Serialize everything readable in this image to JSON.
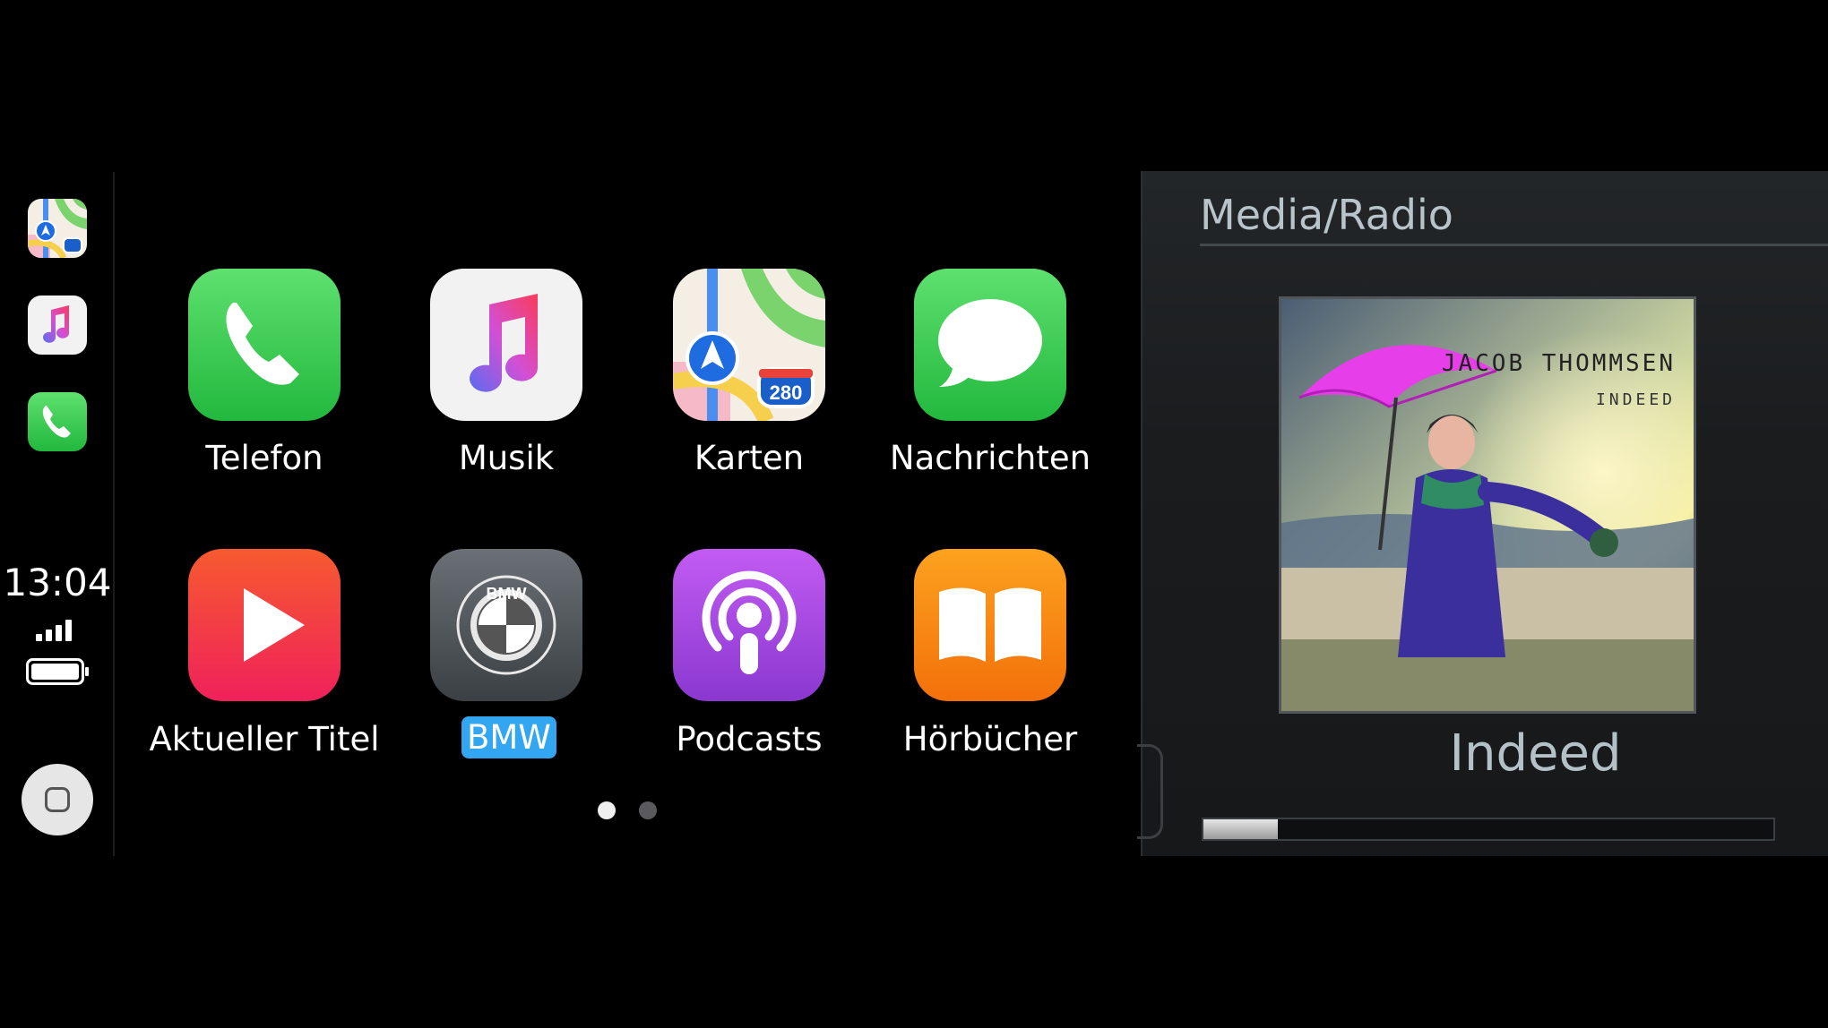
{
  "carplay": {
    "status": {
      "time": "13:04"
    },
    "apps": [
      {
        "id": "telefon",
        "label": "Telefon",
        "icon": "phone-icon"
      },
      {
        "id": "musik",
        "label": "Musik",
        "icon": "music-icon"
      },
      {
        "id": "karten",
        "label": "Karten",
        "icon": "maps-icon",
        "shield": "280"
      },
      {
        "id": "nachrichten",
        "label": "Nachrichten",
        "icon": "messages-icon"
      },
      {
        "id": "aktueller-titel",
        "label": "Aktueller Titel",
        "icon": "now-playing-icon"
      },
      {
        "id": "bmw",
        "label": "BMW",
        "icon": "bmw-logo-icon",
        "logo_text": "BMW",
        "selected": true
      },
      {
        "id": "podcasts",
        "label": "Podcasts",
        "icon": "podcasts-icon"
      },
      {
        "id": "hoerbuecher",
        "label": "Hörbücher",
        "icon": "books-icon"
      }
    ],
    "dock": [
      {
        "icon": "maps-icon"
      },
      {
        "icon": "music-icon"
      },
      {
        "icon": "phone-icon"
      }
    ],
    "page_dots": {
      "count": 2,
      "active": 0
    }
  },
  "media": {
    "title": "Media/Radio",
    "cover": {
      "artist": "JACOB THOMMSEN",
      "album": "INDEED"
    },
    "track": "Indeed",
    "progress": 0.13
  },
  "colors": {
    "selection": "#33a6f2",
    "phone_green": "#2fd158",
    "music_bg": "#f2f2f2",
    "podcasts_purple": "#a54ee0",
    "books_orange": "#f58a0b",
    "now_playing_red": "#f2413a"
  }
}
